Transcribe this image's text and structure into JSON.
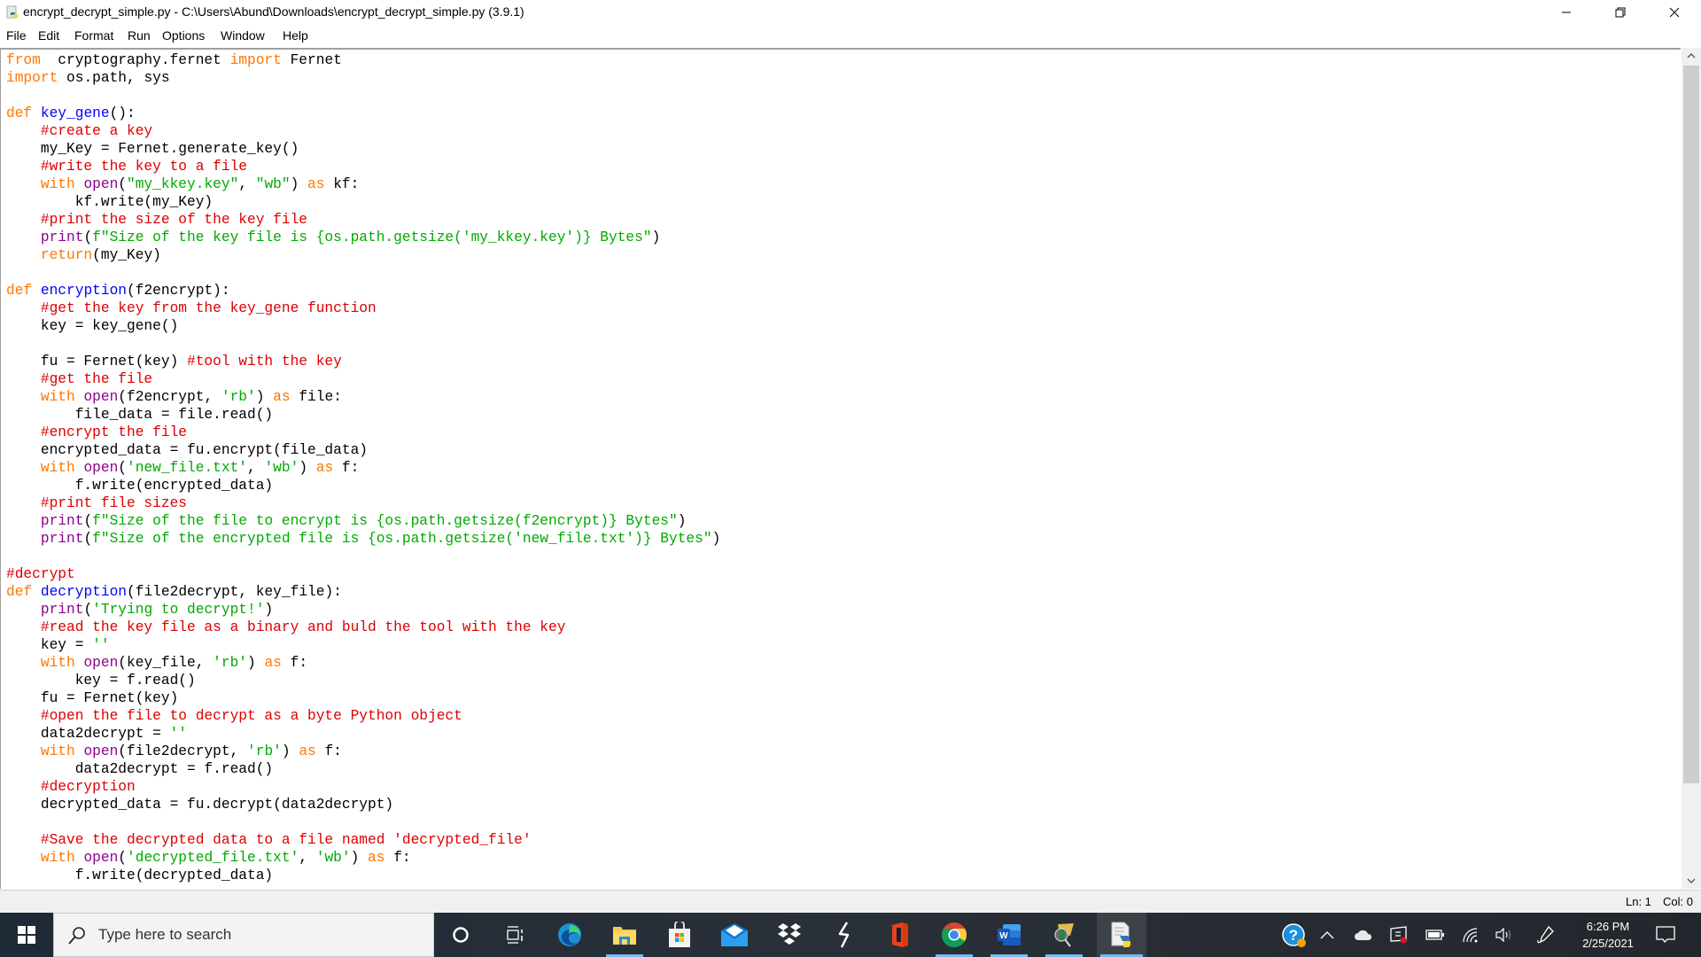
{
  "window": {
    "title": "encrypt_decrypt_simple.py - C:\\Users\\Abund\\Downloads\\encrypt_decrypt_simple.py (3.9.1)",
    "minimize_icon": "minimize-icon",
    "maximize_icon": "restore-icon",
    "close_icon": "close-icon"
  },
  "menu": {
    "items": [
      "File",
      "Edit",
      "Format",
      "Run",
      "Options",
      "Window",
      "Help"
    ]
  },
  "editor": {
    "language": "python",
    "lines": [
      [
        [
          "kw",
          "from"
        ],
        [
          "",
          "  cryptography.fernet "
        ],
        [
          "kw",
          "import"
        ],
        [
          "",
          " Fernet"
        ]
      ],
      [
        [
          "kw",
          "import"
        ],
        [
          "",
          " os.path, sys"
        ]
      ],
      [],
      [
        [
          "kw",
          "def"
        ],
        [
          "",
          " "
        ],
        [
          "def",
          "key_gene"
        ],
        [
          "",
          "():"
        ]
      ],
      [
        [
          "",
          "    "
        ],
        [
          "cm",
          "#create a key"
        ]
      ],
      [
        [
          "",
          "    my_Key = Fernet.generate_key()"
        ]
      ],
      [
        [
          "",
          "    "
        ],
        [
          "cm",
          "#write the key to a file"
        ]
      ],
      [
        [
          "",
          "    "
        ],
        [
          "kw",
          "with"
        ],
        [
          "",
          " "
        ],
        [
          "bi",
          "open"
        ],
        [
          "",
          "("
        ],
        [
          "str",
          "\"my_kkey.key\""
        ],
        [
          "",
          ", "
        ],
        [
          "str",
          "\"wb\""
        ],
        [
          "",
          ") "
        ],
        [
          "kw",
          "as"
        ],
        [
          "",
          " kf:"
        ]
      ],
      [
        [
          "",
          "        kf.write(my_Key)"
        ]
      ],
      [
        [
          "",
          "    "
        ],
        [
          "cm",
          "#print the size of the key file"
        ]
      ],
      [
        [
          "",
          "    "
        ],
        [
          "bi",
          "print"
        ],
        [
          "",
          "("
        ],
        [
          "str",
          "f\"Size of the key file is {os.path.getsize('my_kkey.key')} Bytes\""
        ],
        [
          "",
          ")"
        ]
      ],
      [
        [
          "",
          "    "
        ],
        [
          "kw",
          "return"
        ],
        [
          "",
          "(my_Key)"
        ]
      ],
      [],
      [
        [
          "kw",
          "def"
        ],
        [
          "",
          " "
        ],
        [
          "def",
          "encryption"
        ],
        [
          "",
          "(f2encrypt):"
        ]
      ],
      [
        [
          "",
          "    "
        ],
        [
          "cm",
          "#get the key from the key_gene function"
        ]
      ],
      [
        [
          "",
          "    key = key_gene()"
        ]
      ],
      [],
      [
        [
          "",
          "    fu = Fernet(key) "
        ],
        [
          "cm",
          "#tool with the key"
        ]
      ],
      [
        [
          "",
          "    "
        ],
        [
          "cm",
          "#get the file"
        ]
      ],
      [
        [
          "",
          "    "
        ],
        [
          "kw",
          "with"
        ],
        [
          "",
          " "
        ],
        [
          "bi",
          "open"
        ],
        [
          "",
          "(f2encrypt, "
        ],
        [
          "str",
          "'rb'"
        ],
        [
          "",
          ") "
        ],
        [
          "kw",
          "as"
        ],
        [
          "",
          " file:"
        ]
      ],
      [
        [
          "",
          "        file_data = file.read()"
        ]
      ],
      [
        [
          "",
          "    "
        ],
        [
          "cm",
          "#encrypt the file"
        ]
      ],
      [
        [
          "",
          "    encrypted_data = fu.encrypt(file_data)"
        ]
      ],
      [
        [
          "",
          "    "
        ],
        [
          "kw",
          "with"
        ],
        [
          "",
          " "
        ],
        [
          "bi",
          "open"
        ],
        [
          "",
          "("
        ],
        [
          "str",
          "'new_file.txt'"
        ],
        [
          "",
          ", "
        ],
        [
          "str",
          "'wb'"
        ],
        [
          "",
          ") "
        ],
        [
          "kw",
          "as"
        ],
        [
          "",
          " f:"
        ]
      ],
      [
        [
          "",
          "        f.write(encrypted_data)"
        ]
      ],
      [
        [
          "",
          "    "
        ],
        [
          "cm",
          "#print file sizes"
        ]
      ],
      [
        [
          "",
          "    "
        ],
        [
          "bi",
          "print"
        ],
        [
          "",
          "("
        ],
        [
          "str",
          "f\"Size of the file to encrypt is {os.path.getsize(f2encrypt)} Bytes\""
        ],
        [
          "",
          ")"
        ]
      ],
      [
        [
          "",
          "    "
        ],
        [
          "bi",
          "print"
        ],
        [
          "",
          "("
        ],
        [
          "str",
          "f\"Size of the encrypted file is {os.path.getsize('new_file.txt')} Bytes\""
        ],
        [
          "",
          ")"
        ]
      ],
      [],
      [
        [
          "cm",
          "#decrypt"
        ]
      ],
      [
        [
          "kw",
          "def"
        ],
        [
          "",
          " "
        ],
        [
          "def",
          "decryption"
        ],
        [
          "",
          "(file2decrypt, key_file):"
        ]
      ],
      [
        [
          "",
          "    "
        ],
        [
          "bi",
          "print"
        ],
        [
          "",
          "("
        ],
        [
          "str",
          "'Trying to decrypt!'"
        ],
        [
          "",
          ")"
        ]
      ],
      [
        [
          "",
          "    "
        ],
        [
          "cm",
          "#read the key file as a binary and buld the tool with the key"
        ]
      ],
      [
        [
          "",
          "    key = "
        ],
        [
          "str",
          "''"
        ]
      ],
      [
        [
          "",
          "    "
        ],
        [
          "kw",
          "with"
        ],
        [
          "",
          " "
        ],
        [
          "bi",
          "open"
        ],
        [
          "",
          "(key_file, "
        ],
        [
          "str",
          "'rb'"
        ],
        [
          "",
          ") "
        ],
        [
          "kw",
          "as"
        ],
        [
          "",
          " f:"
        ]
      ],
      [
        [
          "",
          "        key = f.read()"
        ]
      ],
      [
        [
          "",
          "    fu = Fernet(key)"
        ]
      ],
      [
        [
          "",
          "    "
        ],
        [
          "cm",
          "#open the file to decrypt as a byte Python object"
        ]
      ],
      [
        [
          "",
          "    data2decrypt = "
        ],
        [
          "str",
          "''"
        ]
      ],
      [
        [
          "",
          "    "
        ],
        [
          "kw",
          "with"
        ],
        [
          "",
          " "
        ],
        [
          "bi",
          "open"
        ],
        [
          "",
          "(file2decrypt, "
        ],
        [
          "str",
          "'rb'"
        ],
        [
          "",
          ") "
        ],
        [
          "kw",
          "as"
        ],
        [
          "",
          " f:"
        ]
      ],
      [
        [
          "",
          "        data2decrypt = f.read()"
        ]
      ],
      [
        [
          "",
          "    "
        ],
        [
          "cm",
          "#decryption"
        ]
      ],
      [
        [
          "",
          "    decrypted_data = fu.decrypt(data2decrypt)"
        ]
      ],
      [],
      [
        [
          "",
          "    "
        ],
        [
          "cm",
          "#Save the decrypted data to a file named 'decrypted_file'"
        ]
      ],
      [
        [
          "",
          "    "
        ],
        [
          "kw",
          "with"
        ],
        [
          "",
          " "
        ],
        [
          "bi",
          "open"
        ],
        [
          "",
          "("
        ],
        [
          "str",
          "'decrypted_file.txt'"
        ],
        [
          "",
          ", "
        ],
        [
          "str",
          "'wb'"
        ],
        [
          "",
          ") "
        ],
        [
          "kw",
          "as"
        ],
        [
          "",
          " f:"
        ]
      ],
      [
        [
          "",
          "        f.write(decrypted_data)"
        ]
      ]
    ]
  },
  "statusbar": {
    "line": "Ln: 1",
    "col": "Col: 0"
  },
  "taskbar": {
    "search_placeholder": "Type here to search",
    "apps": [
      {
        "name": "cortana",
        "icon": "cortana-icon"
      },
      {
        "name": "task-view",
        "icon": "task-view-icon"
      },
      {
        "name": "edge",
        "icon": "edge-icon"
      },
      {
        "name": "file-explorer",
        "icon": "folder-icon"
      },
      {
        "name": "microsoft-store",
        "icon": "store-icon"
      },
      {
        "name": "mail",
        "icon": "mail-icon"
      },
      {
        "name": "dropbox",
        "icon": "dropbox-icon"
      },
      {
        "name": "app-s",
        "icon": "s-app-icon"
      },
      {
        "name": "office",
        "icon": "office-icon"
      },
      {
        "name": "chrome",
        "icon": "chrome-icon"
      },
      {
        "name": "word",
        "icon": "word-icon"
      },
      {
        "name": "wireshark-like",
        "icon": "network-inspector-icon"
      },
      {
        "name": "python-idle",
        "icon": "python-file-icon"
      }
    ],
    "clock": {
      "time": "6:26 PM",
      "date": "2/25/2021"
    }
  },
  "colors": {
    "keyword": "#ff7700",
    "builtin": "#900090",
    "definition": "#0000ff",
    "string": "#00aa00",
    "comment": "#dd0000",
    "taskbar_underline": "#76b9ed"
  }
}
